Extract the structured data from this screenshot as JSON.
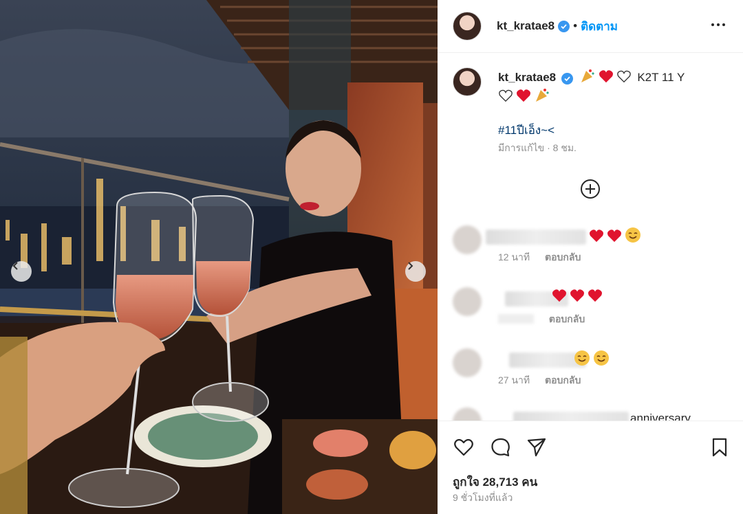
{
  "header": {
    "username": "kt_kratae8",
    "separator": "•",
    "follow_label": "ติดตาม"
  },
  "caption": {
    "username": "kt_kratae8",
    "text": "K2T 11 Y",
    "hashtag": "#11ปีเอ็ง~<",
    "edited": "มีการแก้ไข · 8 ชม."
  },
  "comments": [
    {
      "time": "12 นาที",
      "reply": "ตอบกลับ"
    },
    {
      "time": "",
      "reply": "ตอบกลับ"
    },
    {
      "time": "27 นาที",
      "reply": "ตอบกลับ"
    },
    {
      "text": "anniversary"
    }
  ],
  "footer": {
    "likes": "ถูกใจ 28,713 คน",
    "time": "9 ชั่วโมงที่แล้ว"
  },
  "icons": {
    "verified": "verified-badge-icon",
    "more": "more-options-icon",
    "add": "plus-circle-icon",
    "like": "heart-outline-icon",
    "comment": "comment-icon",
    "share": "paper-plane-icon",
    "save": "bookmark-icon"
  },
  "colors": {
    "accent": "#0095f6",
    "heart_red": "#e0142e",
    "verified": "#3897f0",
    "muted": "#8e8e8e"
  }
}
